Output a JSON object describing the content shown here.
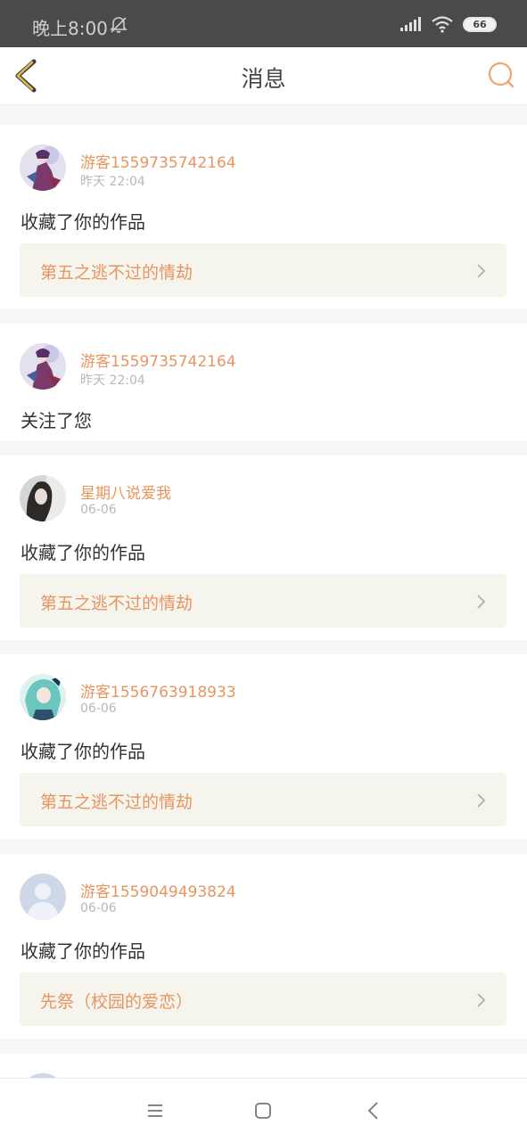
{
  "status_bar": {
    "time": "晚上8:00",
    "battery": "66",
    "icons": [
      "notifications-off-icon",
      "signal-icon",
      "wifi-icon",
      "battery-icon"
    ]
  },
  "header": {
    "title": "消息",
    "back_icon": "back-arrow-icon",
    "search_icon": "search-icon",
    "accent_color": "#e89460",
    "back_color": "#c9a93e"
  },
  "messages": [
    {
      "username": "游客1559735742164",
      "time": "昨天 22:04",
      "action": "收藏了你的作品",
      "work_title": "第五之逃不过的情劫"
    },
    {
      "username": "游客1559735742164",
      "time": "昨天 22:04",
      "action": "关注了您"
    },
    {
      "username": "星期八说爱我",
      "time": "06-06",
      "action": "收藏了你的作品",
      "work_title": "第五之逃不过的情劫"
    },
    {
      "username": "游客1556763918933",
      "time": "06-06",
      "action": "收藏了你的作品",
      "work_title": "第五之逃不过的情劫"
    },
    {
      "username": "游客1559049493824",
      "time": "06-06",
      "action": "收藏了你的作品",
      "work_title": "先祭（校园的爱恋）"
    }
  ],
  "system_nav": {
    "icons": [
      "menu-icon",
      "home-square-icon",
      "back-icon"
    ]
  }
}
